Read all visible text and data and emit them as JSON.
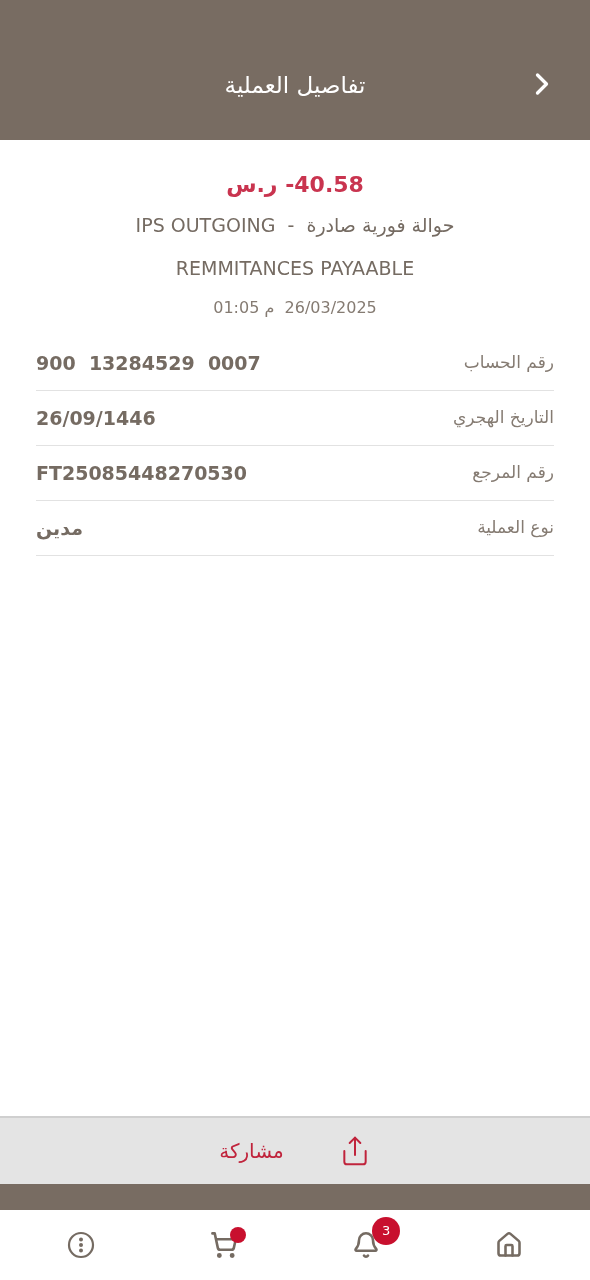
{
  "header": {
    "title": "تفاصيل العملية"
  },
  "summary": {
    "amount": "40.58- ر.س",
    "description": "حوالة فورية صادرة  -  IPS OUTGOING",
    "category": "REMMITANCES PAYAABLE",
    "datetime": "26/03/2025  م 01:05"
  },
  "details": [
    {
      "label": "رقم الحساب",
      "value": "900  13284529  0007"
    },
    {
      "label": "التاريخ الهجري",
      "value": "26/09/1446"
    },
    {
      "label": "رقم المرجع",
      "value": "FT25085448270530"
    },
    {
      "label": "نوع العملية",
      "value": "مدين"
    }
  ],
  "share_button": {
    "label": "مشاركة"
  },
  "bottom_nav": [
    {
      "kind": "home"
    },
    {
      "kind": "bell",
      "badge": "3"
    },
    {
      "kind": "cart",
      "dot": true
    },
    {
      "kind": "more"
    }
  ]
}
